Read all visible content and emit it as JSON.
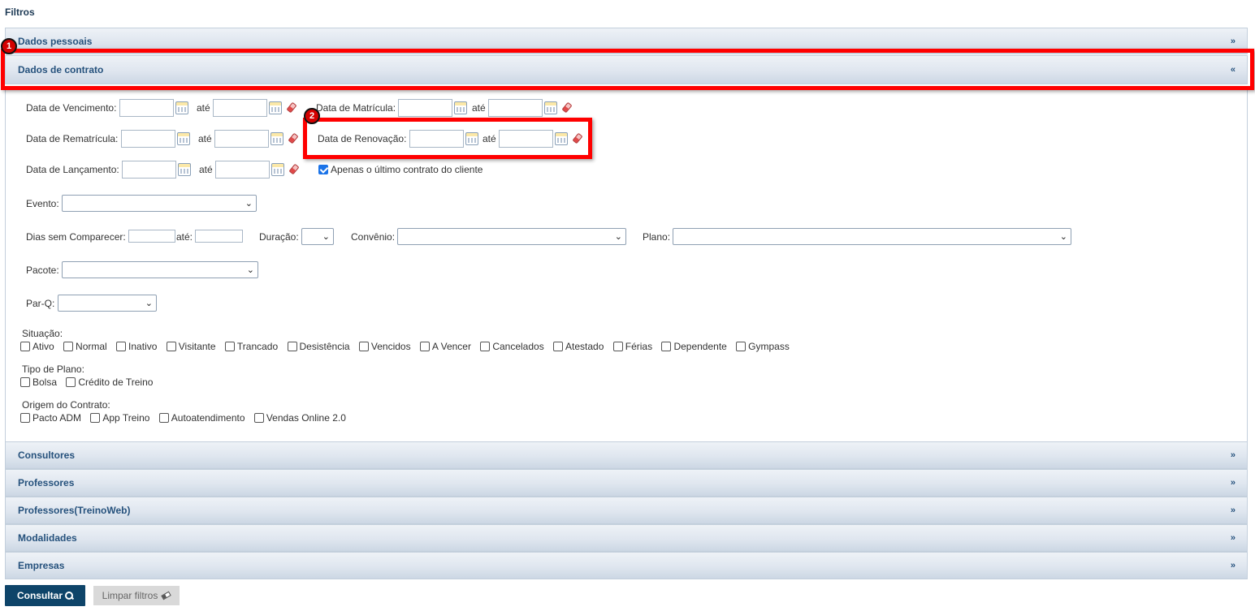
{
  "page_title": "Filtros",
  "sections": {
    "dados_pessoais": "Dados pessoais",
    "dados_contrato": "Dados de contrato",
    "consultores": "Consultores",
    "professores": "Professores",
    "professores_treino": "Professores(TreinoWeb)",
    "modalidades": "Modalidades",
    "empresas": "Empresas",
    "expand_symbol": "»",
    "collapse_symbol": "«"
  },
  "contrato": {
    "vencimento_label": "Data de Vencimento:",
    "rematricula_label": "Data de Rematrícula:",
    "lancamento_label": "Data de Lançamento:",
    "matricula_label": "Data de Matrícula:",
    "renovacao_label": "Data de Renovação:",
    "ate": "até",
    "ultimo_contrato_label": "Apenas o último contrato do cliente",
    "ultimo_contrato_checked": true,
    "evento_label": "Evento:",
    "dias_sem_comparecer_label": "Dias sem Comparecer:",
    "ate_short": "até:",
    "duracao_label": "Duração:",
    "convenio_label": "Convênio:",
    "plano_label": "Plano:",
    "pacote_label": "Pacote:",
    "parq_label": "Par-Q:",
    "situacao_label": "Situação:",
    "situacao_options": [
      "Ativo",
      "Normal",
      "Inativo",
      "Visitante",
      "Trancado",
      "Desistência",
      "Vencidos",
      "A Vencer",
      "Cancelados",
      "Atestado",
      "Férias",
      "Dependente",
      "Gympass"
    ],
    "tipo_plano_label": "Tipo de Plano:",
    "tipo_plano_options": [
      "Bolsa",
      "Crédito de Treino"
    ],
    "origem_label": "Origem do Contrato:",
    "origem_options": [
      "Pacto ADM",
      "App Treino",
      "Autoatendimento",
      "Vendas Online 2.0"
    ]
  },
  "annotations": {
    "badge_1": "1",
    "badge_2": "2",
    "highlight_color": "#ff0000"
  },
  "buttons": {
    "consultar": "Consultar",
    "limpar": "Limpar filtros"
  },
  "icons": {
    "calendar": "calendar-icon",
    "eraser": "eraser-icon",
    "search": "search-icon",
    "dropdown": "chevron-down-icon"
  }
}
